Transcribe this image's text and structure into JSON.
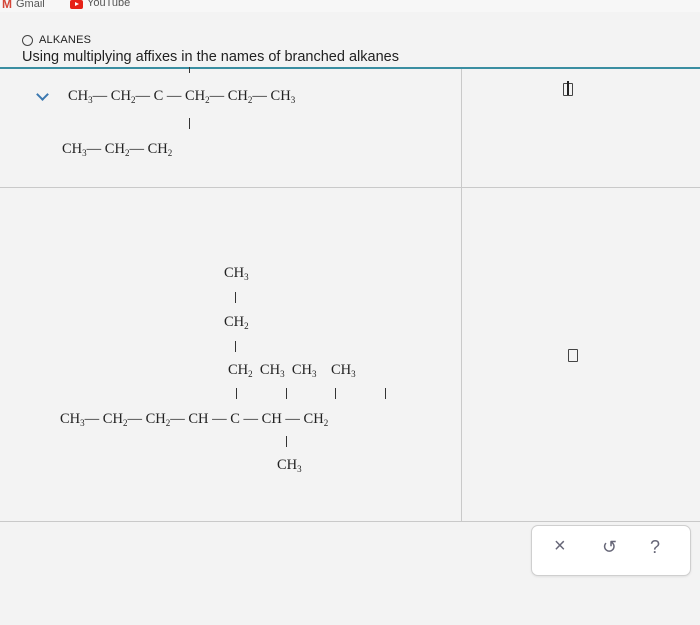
{
  "browser": {
    "bookmarks": [
      {
        "label": "Gmail",
        "icon": "gmail-icon"
      },
      {
        "label": "YouTube",
        "icon": "youtube-icon"
      }
    ]
  },
  "header": {
    "topic": "ALKANES",
    "subtitle": "Using multiplying affixes in the names of branched alkanes"
  },
  "colors": {
    "accent": "#3a8ea1",
    "chevron": "#3b78b0"
  },
  "toolbar": {
    "clear": "×",
    "undo": "↺",
    "help": "?"
  }
}
